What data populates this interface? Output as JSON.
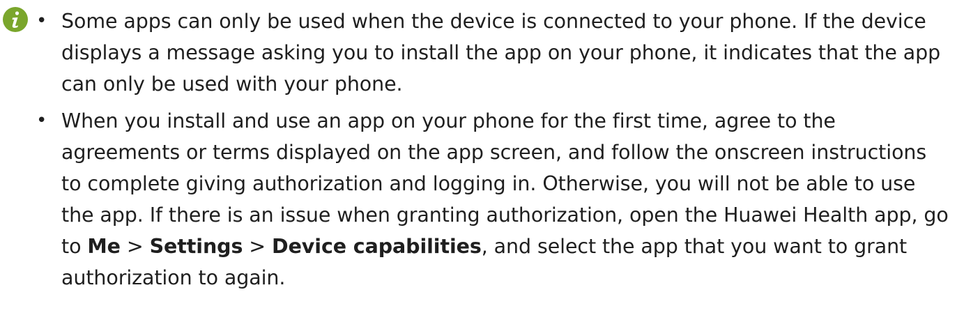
{
  "icons": {
    "info": "info-icon",
    "info_color": "#7aa62c"
  },
  "bullet_symbol": "•",
  "notes": [
    {
      "text": "Some apps can only be used when the device is connected to your phone. If the device displays a message asking you to install the app on your phone, it indicates that the app can only be used with your phone."
    },
    {
      "text_before": "When you install and use an app on your phone for the first time, agree to the agreements or terms displayed on the app screen, and follow the onscreen instructions to complete giving authorization and logging in. Otherwise, you will not be able to use the app. If there is an issue when granting authorization, open the Huawei Health app, go to ",
      "path": [
        "Me",
        "Settings",
        "Device capabilities"
      ],
      "path_separator": " > ",
      "text_after": ", and select the app that you want to grant authorization to again."
    }
  ]
}
